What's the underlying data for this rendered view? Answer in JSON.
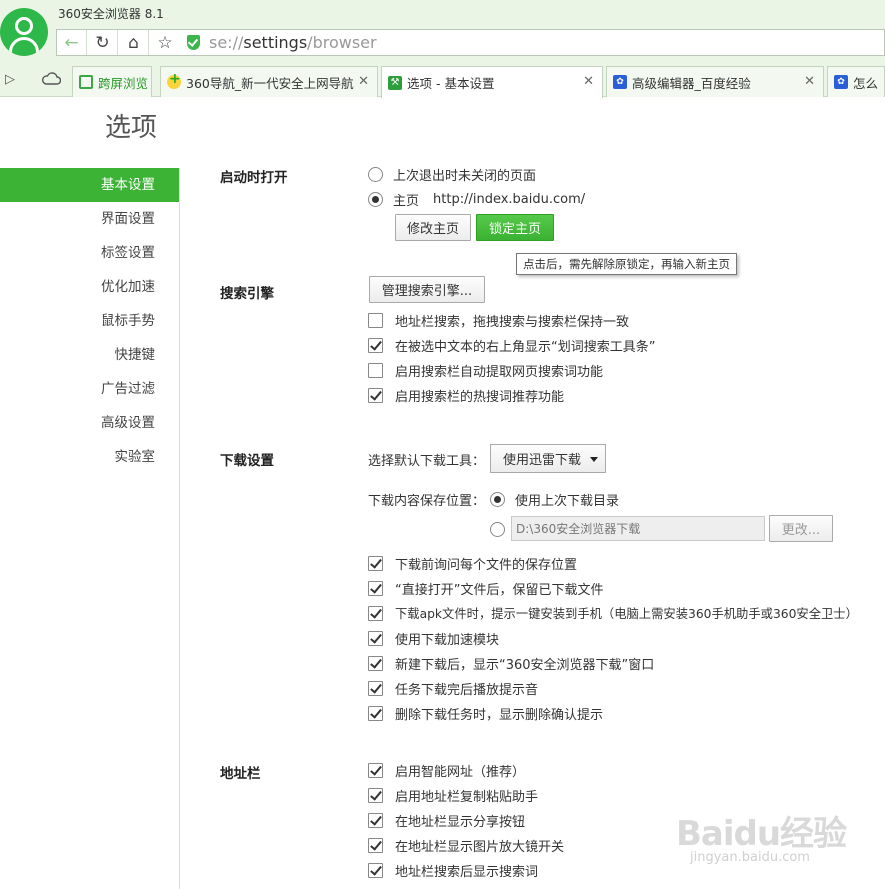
{
  "app": {
    "title": "360安全浏览器 8.1"
  },
  "address_bar": {
    "url_prefix": "se://",
    "url_host": "settings",
    "url_path": "/browser"
  },
  "tabs": [
    {
      "label": "跨屏浏览",
      "icon": "green-square-icon"
    },
    {
      "label": "360导航_新一代安全上网导航",
      "icon": "360-logo-icon"
    },
    {
      "label": "选项 - 基本设置",
      "icon": "wrench-icon",
      "active": true
    },
    {
      "label": "高级编辑器_百度经验",
      "icon": "baidu-paw-icon"
    },
    {
      "label": "怎么",
      "icon": "baidu-paw-icon"
    }
  ],
  "page": {
    "title": "选项"
  },
  "nav": {
    "items": [
      "基本设置",
      "界面设置",
      "标签设置",
      "优化加速",
      "鼠标手势",
      "快捷键",
      "广告过滤",
      "高级设置",
      "实验室"
    ],
    "active_index": 0
  },
  "startup": {
    "title": "启动时打开",
    "option_last": "上次退出时未关闭的页面",
    "option_home": "主页",
    "home_url": "http://index.baidu.com/",
    "btn_modify": "修改主页",
    "btn_lock": "锁定主页",
    "tooltip": "点击后，需先解除原锁定，再输入新主页"
  },
  "search": {
    "title": "搜索引擎",
    "btn_manage": "管理搜索引擎...",
    "options": [
      {
        "label": "地址栏搜索，拖拽搜索与搜索栏保持一致",
        "checked": false
      },
      {
        "label": "在被选中文本的右上角显示“划词搜索工具条”",
        "checked": true
      },
      {
        "label": "启用搜索栏自动提取网页搜索词功能",
        "checked": false
      },
      {
        "label": "启用搜索栏的热搜词推荐功能",
        "checked": true
      }
    ]
  },
  "download": {
    "title": "下载设置",
    "tool_label": "选择默认下载工具：",
    "tool_value": "使用迅雷下载",
    "save_label": "下载内容保存位置：",
    "save_last": "使用上次下载目录",
    "save_path": "D:\\360安全浏览器下载",
    "btn_change": "更改...",
    "options": [
      {
        "label": "下载前询问每个文件的保存位置",
        "checked": true
      },
      {
        "label": "“直接打开”文件后，保留已下载文件",
        "checked": true
      },
      {
        "label": "下载apk文件时，提示一键安装到手机（电脑上需安装360手机助手或360安全卫士）",
        "checked": true
      },
      {
        "label": "使用下载加速模块",
        "checked": true
      },
      {
        "label": "新建下载后，显示“360安全浏览器下载”窗口",
        "checked": true
      },
      {
        "label": "任务下载完后播放提示音",
        "checked": true
      },
      {
        "label": "删除下载任务时，显示删除确认提示",
        "checked": true
      }
    ]
  },
  "addressbar": {
    "title": "地址栏",
    "options": [
      {
        "label": "启用智能网址（推荐）",
        "checked": true
      },
      {
        "label": "启用地址栏复制粘贴助手",
        "checked": true
      },
      {
        "label": "在地址栏显示分享按钮",
        "checked": true
      },
      {
        "label": "在地址栏显示图片放大镜开关",
        "checked": true
      },
      {
        "label": "地址栏搜索后显示搜索词",
        "checked": true
      }
    ]
  },
  "watermark": {
    "main": "Baidu经验",
    "sub": "jingyan.baidu.com"
  },
  "colors": {
    "accent": "#3cb335",
    "chrome_bg": "#eaf5e6"
  }
}
